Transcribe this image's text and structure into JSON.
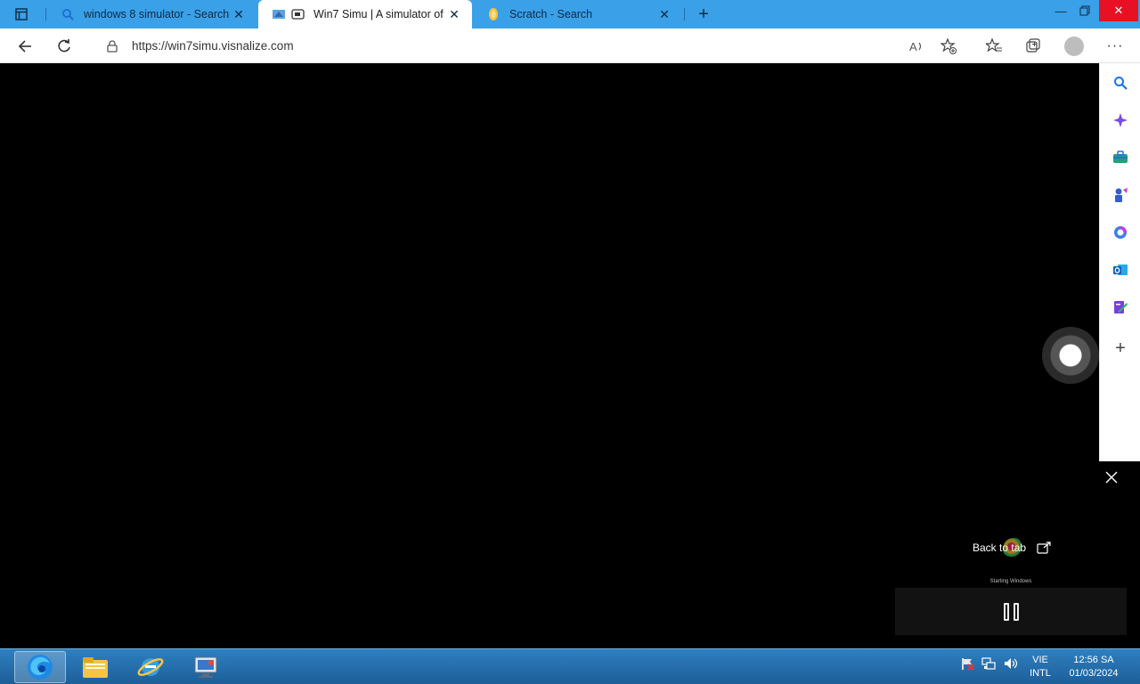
{
  "tabs": [
    {
      "title": "windows 8 simulator - Search",
      "icon": "search-icon"
    },
    {
      "title": "Win7 Simu | A simulator of",
      "icon": "win7simu-favicon"
    },
    {
      "title": "Scratch - Search",
      "icon": "scratch-favicon"
    }
  ],
  "address": {
    "url": "https://win7simu.visnalize.com"
  },
  "pip": {
    "back_to_tab": "Back to tab",
    "starting": "Starting Windows"
  },
  "taskbar": {
    "apps": [
      "edge-icon",
      "file-explorer-icon",
      "internet-explorer-icon",
      "remote-desktop-icon"
    ],
    "tray": [
      "network-flag-icon",
      "network-icon",
      "volume-icon"
    ],
    "lang_top": "VIE",
    "lang_bottom": "INTL",
    "time": "12:56 SA",
    "date": "01/03/2024"
  },
  "sidebar": {
    "icons": [
      "search-icon",
      "copilot-icon",
      "shopping-icon",
      "games-icon",
      "office-icon",
      "outlook-icon",
      "designer-icon",
      "add-icon"
    ]
  },
  "colors": {
    "tabstrip": "#3aa0e8",
    "taskbar": "#1c5f99",
    "close_hover": "#e81123"
  }
}
